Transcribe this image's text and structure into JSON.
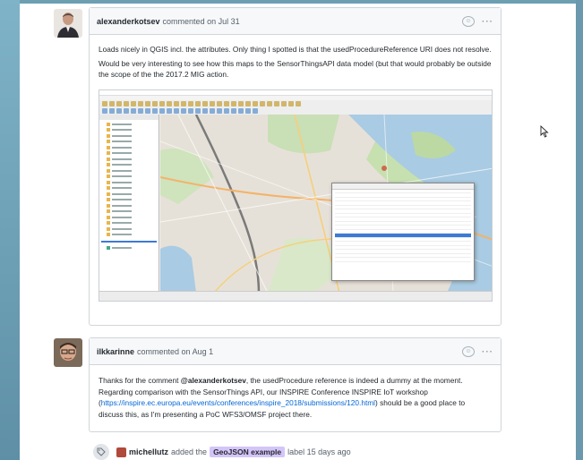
{
  "comments": [
    {
      "author": "alexanderkotsev",
      "meta": "commented on Jul 31",
      "body_p1": "Loads nicely in QGIS incl. the attributes. Only thing I spotted is that the usedProcedureReference URI does not resolve.",
      "body_p2": "Would be very interesting to see how this maps to the SensorThingsAPI data model (but that would probably be outside the scope of the the 2017.2 MIG action."
    },
    {
      "author": "ilkkarinne",
      "meta": "commented on Aug 1",
      "body_pre": "Thanks for the comment ",
      "mention": "@alexanderkotsev",
      "body_mid": ", the usedProcedure reference is indeed a dummy at the moment. Regarding comparison with the SensorThings API, our INSPIRE Conference INSPIRE IoT workshop (",
      "link": "https://inspire.ec.europa.eu/events/conferences/inspire_2018/submissions/120.html",
      "body_post": ") should be a good place to discuss this, as I'm presenting a PoC WFS3/OMSF project there."
    }
  ],
  "timeline": {
    "actor": "michellutz",
    "action": "added the",
    "label": "GeoJSON example",
    "label_color": "#d4c5f9",
    "suffix": "label 15 days ago"
  },
  "icons": {
    "emoji": "smiley-icon",
    "more": "kebab-icon",
    "tag": "tag-icon",
    "cursor": "pointer-icon"
  },
  "header_actions": {
    "emoji_glyph": "☺",
    "more_glyph": "···"
  }
}
